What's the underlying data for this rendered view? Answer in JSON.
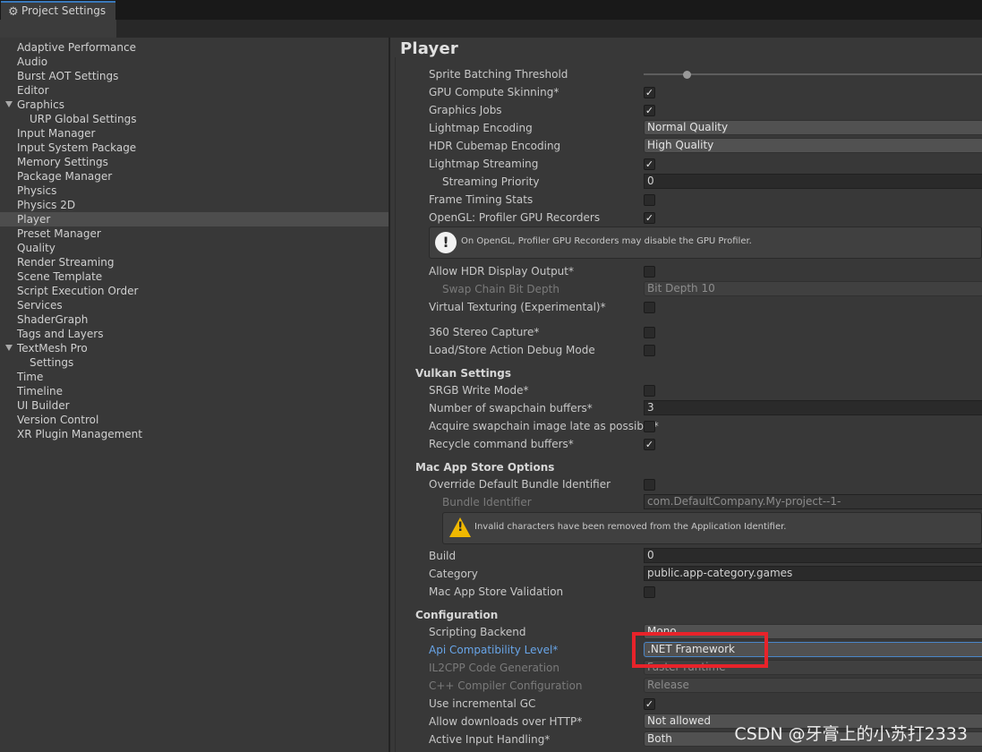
{
  "window": {
    "tab_title": "Project Settings",
    "icon": "gear-icon"
  },
  "sidebar": {
    "items": [
      {
        "label": "Adaptive Performance"
      },
      {
        "label": "Audio"
      },
      {
        "label": "Burst AOT Settings"
      },
      {
        "label": "Editor"
      },
      {
        "label": "Graphics",
        "expanded": true
      },
      {
        "label": "URP Global Settings",
        "child": true
      },
      {
        "label": "Input Manager"
      },
      {
        "label": "Input System Package"
      },
      {
        "label": "Memory Settings"
      },
      {
        "label": "Package Manager"
      },
      {
        "label": "Physics"
      },
      {
        "label": "Physics 2D"
      },
      {
        "label": "Player",
        "selected": true
      },
      {
        "label": "Preset Manager"
      },
      {
        "label": "Quality"
      },
      {
        "label": "Render Streaming"
      },
      {
        "label": "Scene Template"
      },
      {
        "label": "Script Execution Order"
      },
      {
        "label": "Services"
      },
      {
        "label": "ShaderGraph"
      },
      {
        "label": "Tags and Layers"
      },
      {
        "label": "TextMesh Pro",
        "expanded": true
      },
      {
        "label": "Settings",
        "child": true
      },
      {
        "label": "Time"
      },
      {
        "label": "Timeline"
      },
      {
        "label": "UI Builder"
      },
      {
        "label": "Version Control"
      },
      {
        "label": "XR Plugin Management"
      }
    ]
  },
  "main": {
    "header": "Player",
    "rows": {
      "sprite_batching_threshold": "Sprite Batching Threshold",
      "gpu_compute_skinning": "GPU Compute Skinning*",
      "graphics_jobs": "Graphics Jobs",
      "lightmap_encoding": "Lightmap Encoding",
      "lightmap_encoding_value": "Normal Quality",
      "hdr_cubemap_encoding": "HDR Cubemap Encoding",
      "hdr_cubemap_encoding_value": "High Quality",
      "lightmap_streaming": "Lightmap Streaming",
      "streaming_priority": "Streaming Priority",
      "streaming_priority_value": "0",
      "frame_timing_stats": "Frame Timing Stats",
      "opengl_profiler": "OpenGL: Profiler GPU Recorders",
      "opengl_help": "On OpenGL, Profiler GPU Recorders may disable the GPU Profiler.",
      "allow_hdr": "Allow HDR Display Output*",
      "swap_chain_bit_depth": "Swap Chain Bit Depth",
      "swap_chain_bit_depth_value": "Bit Depth 10",
      "virtual_texturing": "Virtual Texturing (Experimental)*",
      "stereo_capture": "360 Stereo Capture*",
      "load_store_debug": "Load/Store Action Debug Mode"
    },
    "vulkan": {
      "title": "Vulkan Settings",
      "srgb_write": "SRGB Write Mode*",
      "swapchain_buffers": "Number of swapchain buffers*",
      "swapchain_buffers_value": "3",
      "acquire_late": "Acquire swapchain image late as possible*",
      "recycle_buffers": "Recycle command buffers*"
    },
    "mac": {
      "title": "Mac App Store Options",
      "override_bundle": "Override Default Bundle Identifier",
      "bundle_identifier": "Bundle Identifier",
      "bundle_identifier_value": "com.DefaultCompany.My-project--1-",
      "warning": "Invalid characters have been removed from the Application Identifier.",
      "build": "Build",
      "build_value": "0",
      "category": "Category",
      "category_value": "public.app-category.games",
      "validation": "Mac App Store Validation"
    },
    "config": {
      "title": "Configuration",
      "scripting_backend": "Scripting Backend",
      "scripting_backend_value": "Mono",
      "api_level": "Api Compatibility Level*",
      "api_level_value": ".NET Framework",
      "il2cpp_gen": "IL2CPP Code Generation",
      "il2cpp_gen_value": "Faster runtime",
      "cpp_config": "C++ Compiler Configuration",
      "cpp_config_value": "Release",
      "incremental_gc": "Use incremental GC",
      "downloads_http": "Allow downloads over HTTP*",
      "downloads_http_value": "Not allowed",
      "input_handling": "Active Input Handling*",
      "input_handling_value": "Both"
    }
  },
  "watermark": "CSDN @牙膏上的小苏打2333",
  "colors": {
    "accent_blue": "#68a5e8",
    "highlight_red": "#e8232a",
    "tab_accent": "#3a79bb"
  }
}
